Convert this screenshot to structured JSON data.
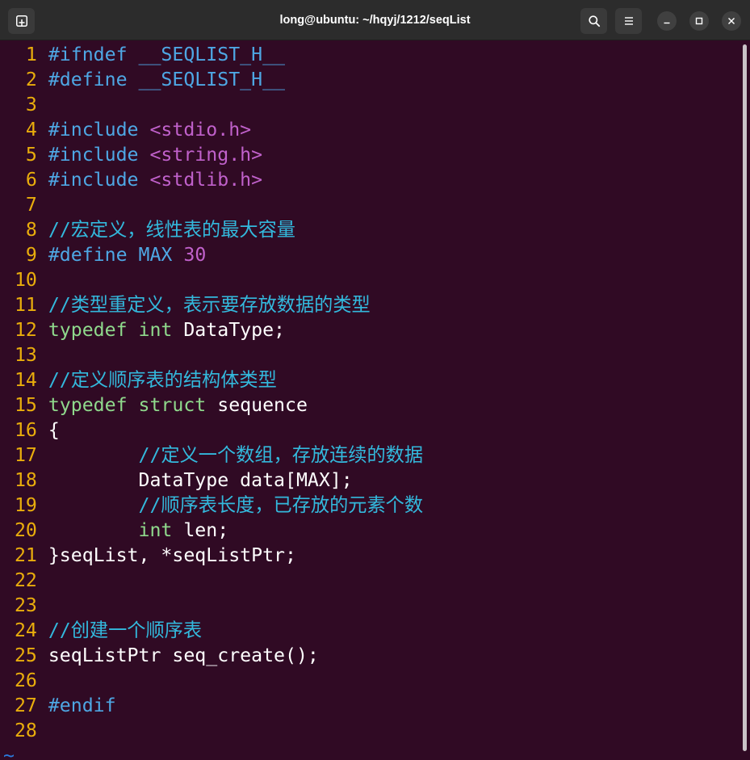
{
  "window": {
    "title": "long@ubuntu: ~/hqyj/1212/seqList",
    "icons": {
      "new_tab": "new-tab-icon",
      "search": "search-icon",
      "menu": "hamburger-menu-icon",
      "minimize": "minimize-icon",
      "maximize": "maximize-icon",
      "close": "close-icon"
    }
  },
  "colors": {
    "titlebar": "#2c2c2c",
    "background": "#300a24",
    "foreground": "#ffffff",
    "line_number": "#e9ad0c",
    "end_of_buffer": "#2a7bde",
    "preproc": "#4ea7e4",
    "comment": "#33b9dd",
    "constant": "#c061cb",
    "type": "#8fd98c"
  },
  "editor": {
    "lines": [
      {
        "number": 1,
        "tokens": [
          {
            "text": "#ifndef __SEQLIST_H__",
            "color": "#4ea7e4"
          }
        ]
      },
      {
        "number": 2,
        "tokens": [
          {
            "text": "#define __SEQLIST_H__",
            "color": "#4ea7e4"
          }
        ]
      },
      {
        "number": 3,
        "tokens": []
      },
      {
        "number": 4,
        "tokens": [
          {
            "text": "#include ",
            "color": "#4ea7e4"
          },
          {
            "text": "<stdio.h>",
            "color": "#c061cb"
          }
        ]
      },
      {
        "number": 5,
        "tokens": [
          {
            "text": "#include ",
            "color": "#4ea7e4"
          },
          {
            "text": "<string.h>",
            "color": "#c061cb"
          }
        ]
      },
      {
        "number": 6,
        "tokens": [
          {
            "text": "#include ",
            "color": "#4ea7e4"
          },
          {
            "text": "<stdlib.h>",
            "color": "#c061cb"
          }
        ]
      },
      {
        "number": 7,
        "tokens": []
      },
      {
        "number": 8,
        "tokens": [
          {
            "text": "//宏定义，线性表的最大容量",
            "color": "#33b9dd"
          }
        ]
      },
      {
        "number": 9,
        "tokens": [
          {
            "text": "#define MAX ",
            "color": "#4ea7e4"
          },
          {
            "text": "30",
            "color": "#c061cb"
          }
        ]
      },
      {
        "number": 10,
        "tokens": []
      },
      {
        "number": 11,
        "tokens": [
          {
            "text": "//类型重定义，表示要存放数据的类型",
            "color": "#33b9dd"
          }
        ]
      },
      {
        "number": 12,
        "tokens": [
          {
            "text": "typedef int",
            "color": "#8fd98c"
          },
          {
            "text": " DataType;"
          }
        ]
      },
      {
        "number": 13,
        "tokens": []
      },
      {
        "number": 14,
        "tokens": [
          {
            "text": "//定义顺序表的结构体类型",
            "color": "#33b9dd"
          }
        ]
      },
      {
        "number": 15,
        "tokens": [
          {
            "text": "typedef struct",
            "color": "#8fd98c"
          },
          {
            "text": " sequence"
          }
        ]
      },
      {
        "number": 16,
        "tokens": [
          {
            "text": "{"
          }
        ]
      },
      {
        "number": 17,
        "tokens": [
          {
            "text": "        //定义一个数组，存放连续的数据",
            "color": "#33b9dd"
          }
        ]
      },
      {
        "number": 18,
        "tokens": [
          {
            "text": "        DataType data[MAX];"
          }
        ]
      },
      {
        "number": 19,
        "tokens": [
          {
            "text": "        //顺序表长度，已存放的元素个数",
            "color": "#33b9dd"
          }
        ]
      },
      {
        "number": 20,
        "tokens": [
          {
            "text": "        int",
            "color": "#8fd98c"
          },
          {
            "text": " len;"
          }
        ]
      },
      {
        "number": 21,
        "tokens": [
          {
            "text": "}seqList, *seqListPtr;"
          }
        ]
      },
      {
        "number": 22,
        "tokens": []
      },
      {
        "number": 23,
        "tokens": []
      },
      {
        "number": 24,
        "tokens": [
          {
            "text": "//创建一个顺序表",
            "color": "#33b9dd"
          }
        ]
      },
      {
        "number": 25,
        "tokens": [
          {
            "text": "seqListPtr seq_create();"
          }
        ]
      },
      {
        "number": 26,
        "tokens": []
      },
      {
        "number": 27,
        "tokens": [
          {
            "text": "#endif",
            "color": "#4ea7e4"
          }
        ]
      },
      {
        "number": 28,
        "tokens": []
      }
    ],
    "filler": "~"
  }
}
